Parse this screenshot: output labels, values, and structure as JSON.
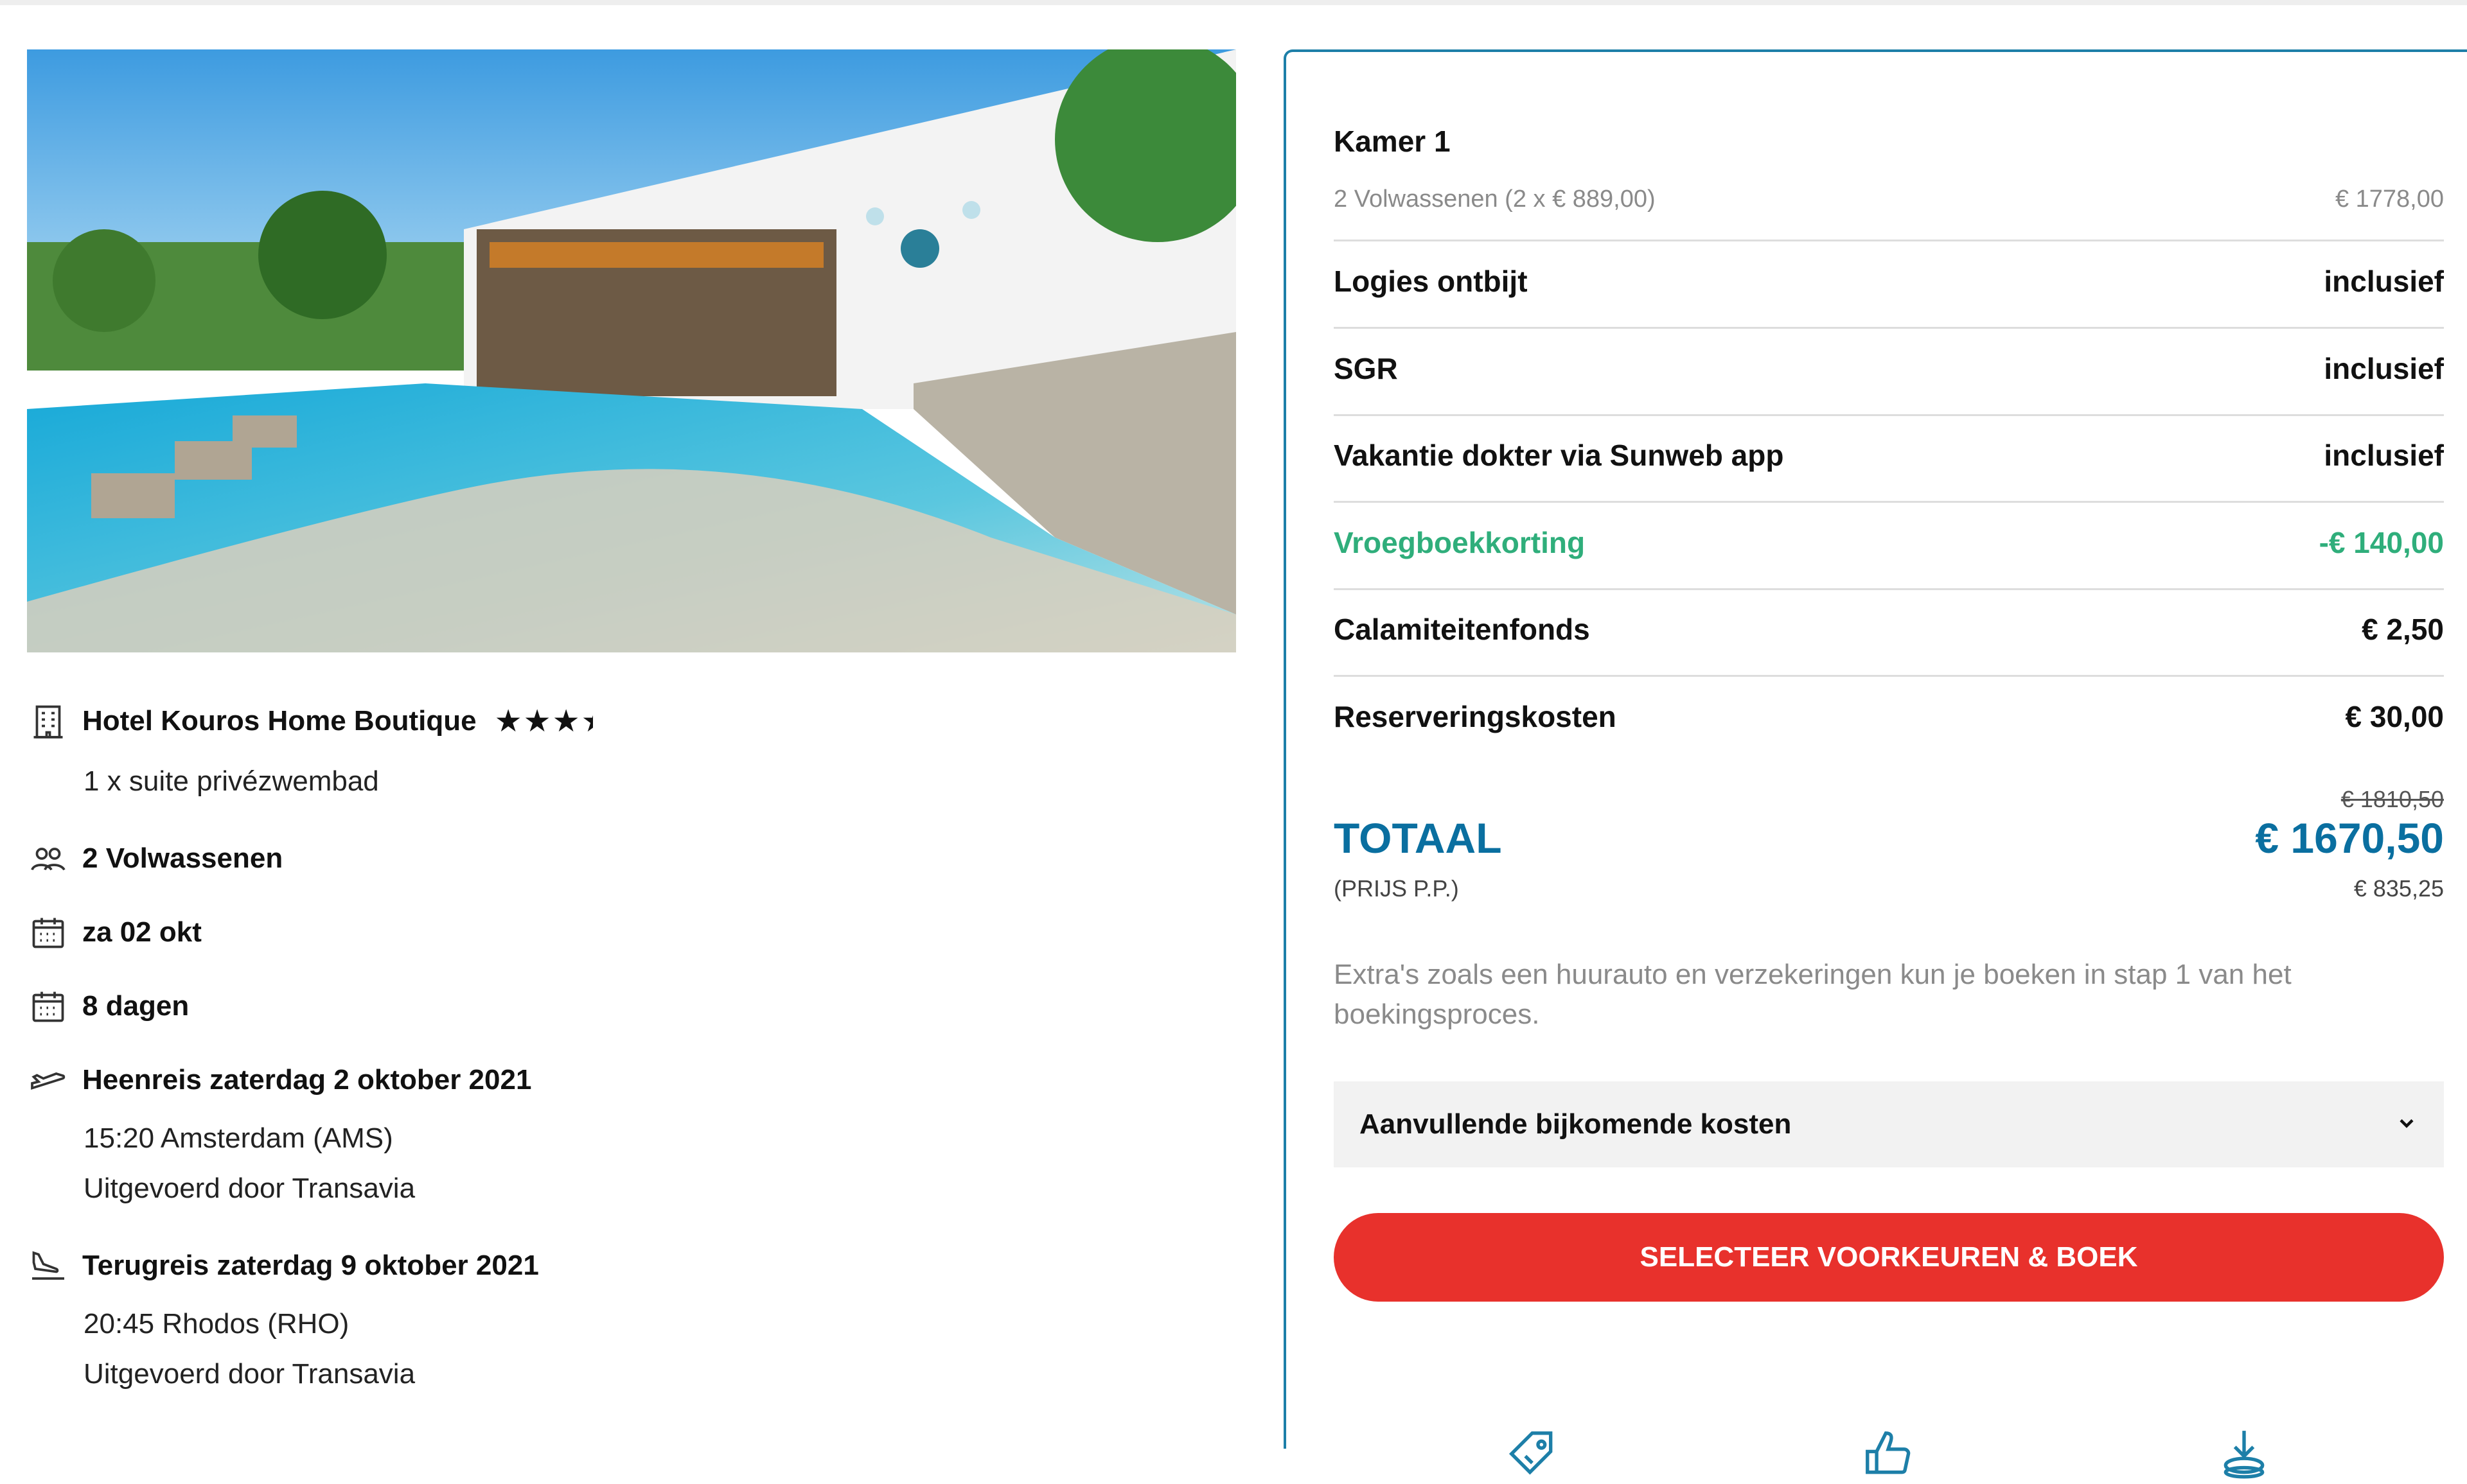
{
  "hotel": {
    "name": "Hotel Kouros Home Boutique",
    "room": "1 x suite privézwembad",
    "stars_glyph": "★★★",
    "half_star_glyph": "★",
    "rating_stars": 3.5
  },
  "details": {
    "travelers": "2 Volwassenen",
    "date": "za 02 okt",
    "duration": "8 dagen",
    "outbound": {
      "title": "Heenreis zaterdag 2 oktober 2021",
      "departure": "15:20 Amsterdam (AMS)",
      "operator": "Uitgevoerd door Transavia"
    },
    "return": {
      "title": "Terugreis zaterdag 9 oktober 2021",
      "departure": "20:45 Rhodos (RHO)",
      "operator": "Uitgevoerd door Transavia"
    }
  },
  "summary": {
    "room_title": "Kamer 1",
    "room_detail": "2 Volwassenen (2 x € 889,00)",
    "room_price": "€ 1778,00",
    "items": [
      {
        "label": "Logies ontbijt",
        "value": "inclusief"
      },
      {
        "label": "SGR",
        "value": "inclusief"
      },
      {
        "label": "Vakantie dokter via Sunweb app",
        "value": "inclusief"
      },
      {
        "label": "Vroegboekkorting",
        "value": "-€ 140,00",
        "highlight": "green"
      },
      {
        "label": "Calamiteitenfonds",
        "value": "€ 2,50"
      },
      {
        "label": "Reserveringskosten",
        "value": "€ 30,00"
      }
    ],
    "old_total": "€ 1810,50",
    "total_label": "TOTAAL",
    "total": "€ 1670,50",
    "per_person_label": "(PRIJS P.P.)",
    "per_person": "€ 835,25",
    "note": "Extra's zoals een huurauto en verzekeringen kun je boeken in stap 1 van het boekingsproces.",
    "accordion_label": "Aanvullende bijkomende kosten",
    "accordion_icon": "chevron-down-icon",
    "cta_label": "SELECTEER VOORKEUREN & BOEK"
  },
  "colors": {
    "accent_blue": "#0a6fa0",
    "panel_border": "#1d7fa8",
    "discount_green": "#2fae7b",
    "cta_red": "#e8312c"
  },
  "usp_icons": [
    "price-tag-icon",
    "thumbs-up-icon",
    "download-icon"
  ]
}
